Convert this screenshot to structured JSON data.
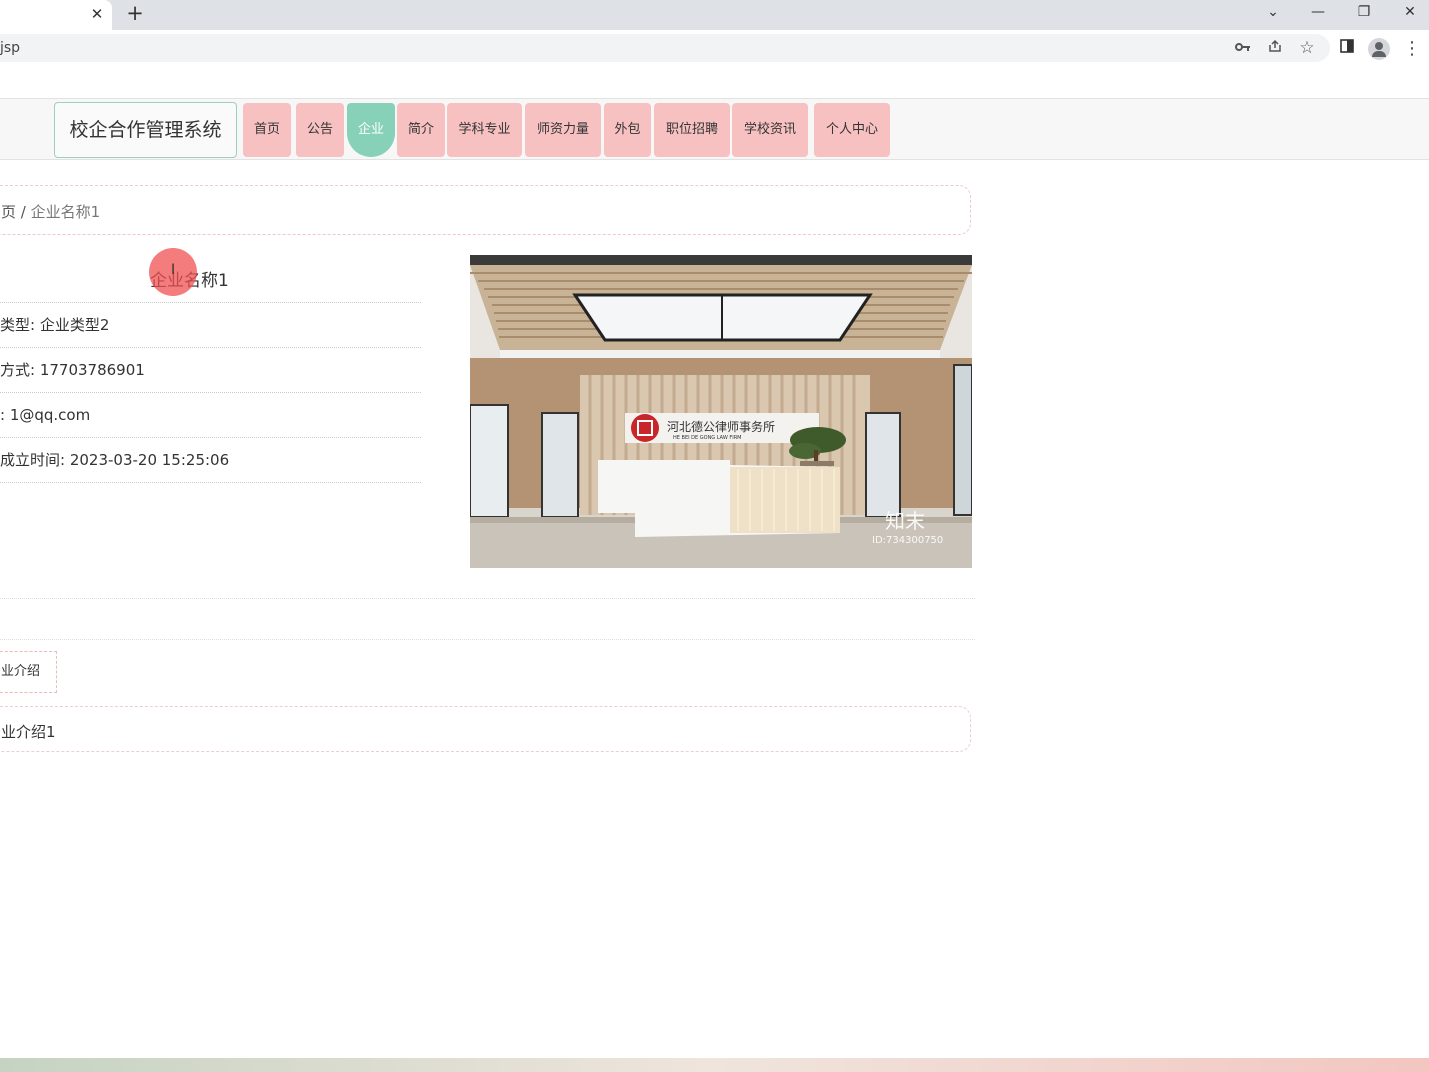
{
  "browser": {
    "tab_close": "✕",
    "new_tab": "+",
    "url": "jsp",
    "window_controls": {
      "tab_search": "⌄",
      "minimize": "—",
      "restore": "❐",
      "close": "✕"
    },
    "icons": {
      "key": "key-icon",
      "share": "share-icon",
      "star": "☆",
      "sidebar": "sidebar-icon",
      "profile": "profile-icon",
      "menu": "⋮"
    }
  },
  "header": {
    "brand": "校企合作管理系统",
    "nav": [
      "首页",
      "公告",
      "企业",
      "简介",
      "学科专业",
      "师资力量",
      "外包",
      "职位招聘",
      "学校资讯",
      "个人中心"
    ],
    "active_index": 2
  },
  "breadcrumb": {
    "home": "页",
    "separator": " / ",
    "current": "企业名称1"
  },
  "detail": {
    "title_covered": "企业",
    "title_rest": "名称1",
    "rows": [
      "类型: 企业类型2",
      "方式: 17703786901",
      ": 1@qq.com",
      "成立时间: 2023-03-20 15:25:06"
    ],
    "image": {
      "sign_cn": "河北德公律师事务所",
      "sign_en": "HE BEI DE GONG LAW FIRM",
      "watermark_cn": "知末",
      "watermark_id": "ID:734300750"
    }
  },
  "intro": {
    "tab_label": "业介绍",
    "content": "业介绍1"
  },
  "colors": {
    "nav_bg": "#f7c1c1",
    "nav_active": "#86d1b8",
    "brand_border": "#9bd0bd"
  }
}
